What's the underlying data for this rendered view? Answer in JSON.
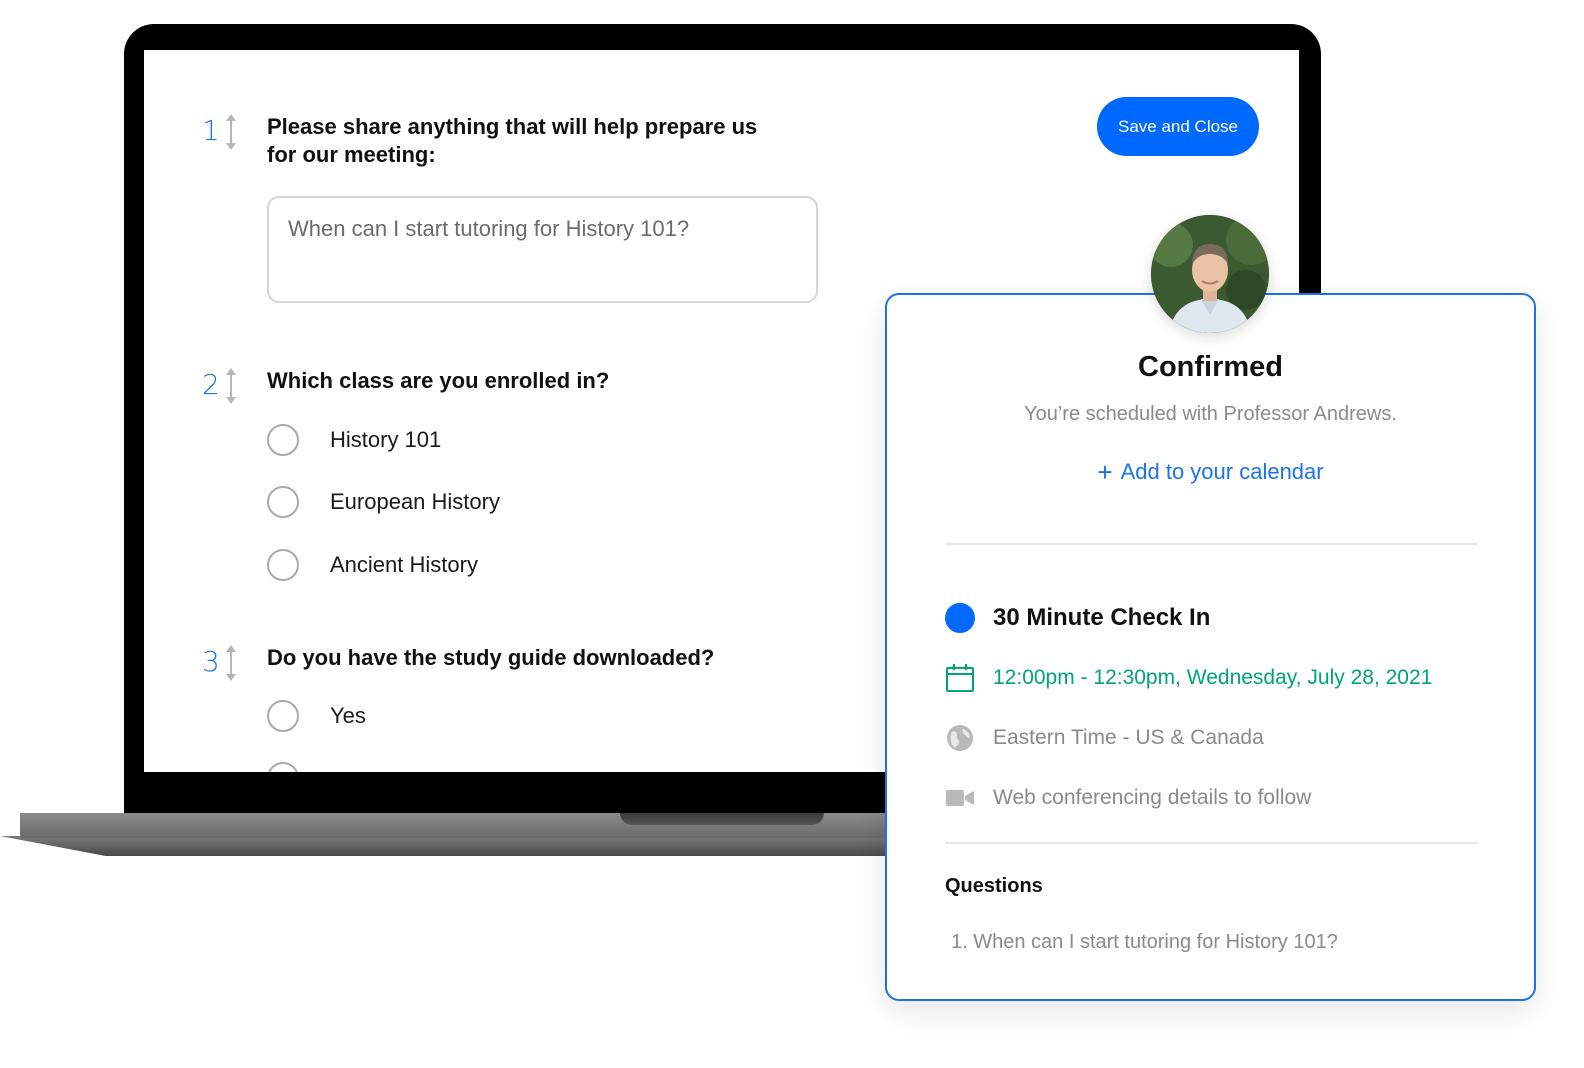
{
  "form": {
    "save_button": "Save and Close",
    "questions": [
      {
        "number": "1",
        "title_line1": "Please share anything that will help prepare us",
        "title_line2": "for our meeting:",
        "answer": "When can I start tutoring for History 101?"
      },
      {
        "number": "2",
        "title": "Which class are you enrolled in?",
        "options": [
          "History 101",
          "European History",
          "Ancient History"
        ]
      },
      {
        "number": "3",
        "title": "Do you have the study guide downloaded?",
        "options": [
          "Yes"
        ]
      }
    ]
  },
  "confirmation": {
    "title": "Confirmed",
    "subtitle": "You’re scheduled with Professor Andrews.",
    "add_calendar": "Add to your calendar",
    "event_name": "30 Minute Check In",
    "event_time": "12:00pm - 12:30pm, Wednesday, July 28, 2021",
    "timezone": "Eastern Time - US & Canada",
    "conferencing": "Web conferencing details to follow",
    "questions_heading": "Questions",
    "question_1": "1. When can I start tutoring for History 101?",
    "colors": {
      "accent_blue": "#0069ff",
      "time_green": "#00a37a",
      "event_dot": "#0069ff"
    },
    "icons": [
      "calendar-icon",
      "globe-icon",
      "video-camera-icon",
      "plus-icon"
    ]
  }
}
